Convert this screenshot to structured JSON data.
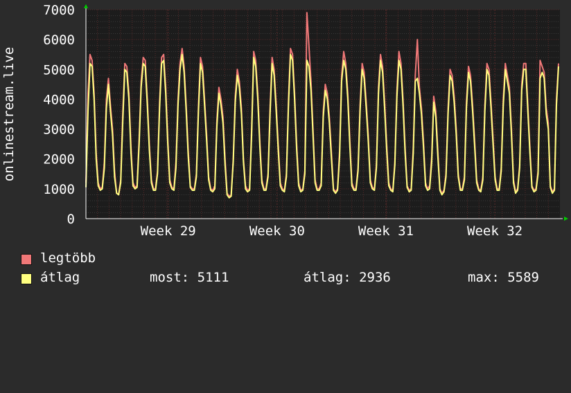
{
  "chart_data": {
    "type": "line",
    "ylabel": "onlinestream.live",
    "ylim": [
      0,
      7000
    ],
    "yticks": [
      0,
      1000,
      2000,
      3000,
      4000,
      5000,
      6000,
      7000
    ],
    "x_ticks": [
      "Week 29",
      "Week 30",
      "Week 31",
      "Week 32"
    ],
    "grid": true,
    "colors": {
      "background": "#2b2b2b",
      "plot": "#1c1c1c",
      "grid": "#3a3a3a",
      "minor_grid": "#5a2a2a",
      "max": "#f07878",
      "avg": "#ffff80",
      "axis_arrow": "#00cc00"
    },
    "series": [
      {
        "name": "legtöbb",
        "color": "#f07878",
        "values": [
          1200,
          4200,
          5500,
          5300,
          4200,
          2200,
          1200,
          1000,
          1050,
          1900,
          4000,
          4700,
          3800,
          3000,
          1600,
          850,
          820,
          1300,
          3500,
          5200,
          5100,
          4200,
          2400,
          1200,
          1050,
          1100,
          2700,
          4600,
          5400,
          5300,
          4000,
          2500,
          1300,
          1000,
          1000,
          1600,
          3900,
          5400,
          5500,
          4400,
          2700,
          1300,
          1050,
          1000,
          1900,
          4000,
          5200,
          5700,
          5100,
          3800,
          2300,
          1100,
          1000,
          1000,
          1500,
          3800,
          5400,
          5100,
          4000,
          2800,
          1400,
          1000,
          950,
          1100,
          3300,
          4400,
          4000,
          3400,
          2000,
          850,
          750,
          800,
          2000,
          4100,
          5000,
          4600,
          3700,
          2000,
          1100,
          950,
          1000,
          3000,
          5600,
          5300,
          4200,
          2600,
          1300,
          1000,
          1000,
          1500,
          3700,
          5400,
          5000,
          3800,
          2500,
          1200,
          1000,
          950,
          1500,
          4000,
          5700,
          5500,
          4200,
          2500,
          1200,
          950,
          1000,
          1600,
          6900,
          5800,
          4600,
          3000,
          1300,
          1000,
          1000,
          1200,
          3600,
          4500,
          4200,
          3400,
          2200,
          1000,
          900,
          1000,
          2300,
          4800,
          5600,
          5200,
          4200,
          2600,
          1200,
          1000,
          1000,
          1700,
          3800,
          5200,
          4900,
          3900,
          2800,
          1300,
          1050,
          1000,
          1800,
          4400,
          5500,
          5100,
          3900,
          2500,
          1200,
          1000,
          950,
          1900,
          4300,
          5600,
          5200,
          4000,
          2400,
          1100,
          950,
          1000,
          2400,
          4800,
          6000,
          4400,
          3700,
          2600,
          1200,
          1000,
          1100,
          2100,
          4100,
          3600,
          2300,
          1000,
          850,
          950,
          1500,
          3700,
          5000,
          4800,
          4100,
          3000,
          1500,
          1000,
          1000,
          1400,
          3900,
          5100,
          4800,
          3800,
          2600,
          1300,
          1000,
          950,
          1400,
          3800,
          5200,
          5000,
          3900,
          2700,
          1400,
          1000,
          1000,
          1700,
          4000,
          5200,
          4800,
          4400,
          3000,
          1300,
          900,
          1000,
          1800,
          4500,
          5200,
          5200,
          3800,
          2400,
          1100,
          950,
          1000,
          1600,
          5300,
          5100,
          4900,
          3700,
          3200,
          1100,
          900,
          1000,
          4000,
          5200
        ]
      },
      {
        "name": "átlag",
        "color": "#ffff80",
        "values": [
          1050,
          3600,
          5200,
          5100,
          4000,
          2000,
          1100,
          950,
          1000,
          1700,
          3700,
          4500,
          3600,
          2800,
          1400,
          850,
          800,
          1200,
          3200,
          5000,
          4900,
          4000,
          2200,
          1100,
          1000,
          1050,
          2500,
          4400,
          5200,
          5100,
          3800,
          2300,
          1200,
          950,
          950,
          1500,
          3700,
          5200,
          5300,
          4200,
          2500,
          1200,
          1000,
          950,
          1700,
          3800,
          5000,
          5500,
          4900,
          3600,
          2100,
          1050,
          950,
          950,
          1400,
          3600,
          5200,
          4900,
          3800,
          2600,
          1300,
          950,
          900,
          1000,
          3100,
          4200,
          3800,
          3200,
          1800,
          800,
          700,
          750,
          1900,
          3900,
          4800,
          4400,
          3500,
          1900,
          1000,
          900,
          950,
          2800,
          5400,
          5100,
          4000,
          2400,
          1200,
          950,
          950,
          1400,
          3500,
          5200,
          4800,
          3600,
          2300,
          1100,
          950,
          900,
          1400,
          3800,
          5500,
          5300,
          4000,
          2300,
          1100,
          900,
          950,
          1500,
          5300,
          5100,
          4300,
          2800,
          1200,
          950,
          950,
          1100,
          3400,
          4300,
          4000,
          3200,
          2000,
          950,
          850,
          950,
          2100,
          4600,
          5300,
          5000,
          4000,
          2400,
          1100,
          950,
          950,
          1600,
          3600,
          5000,
          4700,
          3700,
          2600,
          1200,
          1000,
          950,
          1700,
          4200,
          5300,
          4900,
          3700,
          2300,
          1100,
          950,
          900,
          1800,
          4100,
          5300,
          5000,
          3800,
          2200,
          1050,
          900,
          950,
          2200,
          4600,
          4700,
          4200,
          3500,
          2400,
          1100,
          950,
          1000,
          1900,
          3900,
          3400,
          2100,
          950,
          800,
          900,
          1400,
          3500,
          4800,
          4600,
          3900,
          2800,
          1400,
          950,
          950,
          1300,
          3700,
          4900,
          4600,
          3600,
          2400,
          1200,
          950,
          900,
          1300,
          3600,
          5000,
          4800,
          3700,
          2500,
          1300,
          950,
          950,
          1600,
          3800,
          5000,
          4600,
          4200,
          2800,
          1200,
          850,
          950,
          1700,
          4300,
          5000,
          5000,
          3600,
          2200,
          1050,
          900,
          950,
          1500,
          4700,
          4900,
          4700,
          3500,
          3000,
          1050,
          850,
          950,
          3800,
          5100
        ]
      }
    ]
  },
  "legend": {
    "max_label": "legtöbb",
    "avg_label": "átlag",
    "stat_now": "most: 5111",
    "stat_avg": "átlag: 2936",
    "stat_max": "max: 5589"
  }
}
